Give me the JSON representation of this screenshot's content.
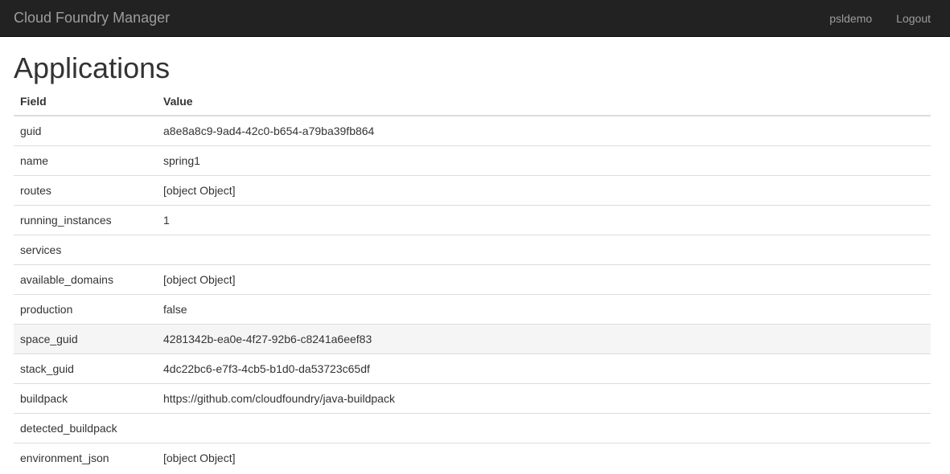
{
  "navbar": {
    "brand": "Cloud Foundry Manager",
    "user": "psldemo",
    "logout": "Logout"
  },
  "page": {
    "title": "Applications"
  },
  "table": {
    "headers": {
      "field": "Field",
      "value": "Value"
    },
    "rows": [
      {
        "field": "guid",
        "value": "a8e8a8c9-9ad4-42c0-b654-a79ba39fb864"
      },
      {
        "field": "name",
        "value": "spring1"
      },
      {
        "field": "routes",
        "value": "[object Object]"
      },
      {
        "field": "running_instances",
        "value": "1"
      },
      {
        "field": "services",
        "value": ""
      },
      {
        "field": "available_domains",
        "value": "[object Object]"
      },
      {
        "field": "production",
        "value": "false"
      },
      {
        "field": "space_guid",
        "value": "4281342b-ea0e-4f27-92b6-c8241a6eef83"
      },
      {
        "field": "stack_guid",
        "value": "4dc22bc6-e7f3-4cb5-b1d0-da53723c65df"
      },
      {
        "field": "buildpack",
        "value": "https://github.com/cloudfoundry/java-buildpack"
      },
      {
        "field": "detected_buildpack",
        "value": ""
      },
      {
        "field": "environment_json",
        "value": "[object Object]"
      }
    ]
  },
  "colors": {
    "navbar_bg": "#222222",
    "navbar_text": "#9d9d9d",
    "row_hover_bg": "#f5f5f5",
    "border": "#dddddd"
  }
}
